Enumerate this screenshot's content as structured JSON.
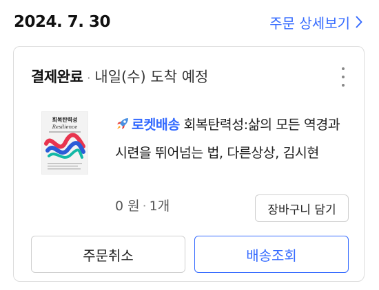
{
  "header": {
    "date": "2024. 7. 30",
    "detail_link_label": "주문 상세보기"
  },
  "order": {
    "status": "결제완료",
    "separator": "·",
    "delivery_eta": "내일(수) 도착 예정",
    "product": {
      "badge_label": "로켓배송",
      "name": "회복탄력성:삶의 모든 역경과 시련을 뛰어넘는 법, 다른상상, 김시현",
      "cover_title": "회복탄력성",
      "cover_subtitle": "Resilience",
      "price": "0 원",
      "quantity": "1개"
    },
    "buttons": {
      "add_to_cart": "장바구니 담기",
      "cancel": "주문취소",
      "track": "배송조회"
    }
  },
  "colors": {
    "accent": "#346aff",
    "border": "#dcdcdc"
  },
  "icons": {
    "detail_link": "chevron-right-icon",
    "menu": "more-vertical-icon",
    "badge": "rocket-icon"
  }
}
